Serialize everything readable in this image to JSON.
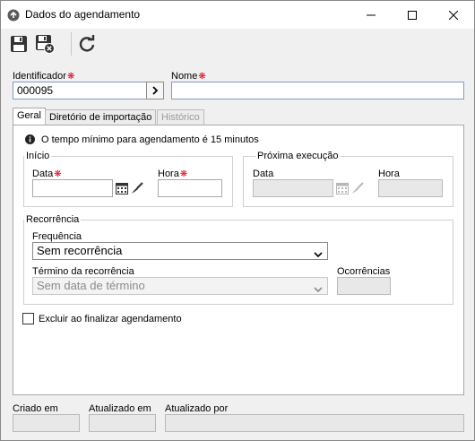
{
  "window": {
    "title": "Dados do agendamento",
    "icon": "app-circle-icon"
  },
  "toolbar": {
    "save_icon": "save-icon",
    "save_close_icon": "save-and-close-icon",
    "refresh_icon": "refresh-icon"
  },
  "form": {
    "identificador_label": "Identificador",
    "identificador_value": "000095",
    "nome_label": "Nome",
    "nome_value": ""
  },
  "tabs": [
    {
      "label": "Geral",
      "state": "active"
    },
    {
      "label": "Diretório de importação",
      "state": "normal"
    },
    {
      "label": "Histórico",
      "state": "disabled"
    }
  ],
  "geral": {
    "info_text": "O tempo mínimo para agendamento é 15 minutos",
    "inicio": {
      "title": "Início",
      "data_label": "Data",
      "data_value": "",
      "hora_label": "Hora",
      "hora_value": ""
    },
    "proxima": {
      "title": "Próxima execução",
      "data_label": "Data",
      "hora_label": "Hora"
    },
    "recorrencia": {
      "title": "Recorrência",
      "frequencia_label": "Frequência",
      "frequencia_value": "Sem recorrência",
      "termino_label": "Término da recorrência",
      "termino_value": "Sem data de término",
      "ocorrencias_label": "Ocorrências",
      "ocorrencias_value": ""
    },
    "excluir_label": "Excluir ao finalizar agendamento",
    "excluir_checked": false
  },
  "footer": {
    "criado_em_label": "Criado em",
    "atualizado_em_label": "Atualizado em",
    "atualizado_por_label": "Atualizado por"
  },
  "colors": {
    "required": "#e0001a",
    "input_border": "#7a9cc8"
  }
}
